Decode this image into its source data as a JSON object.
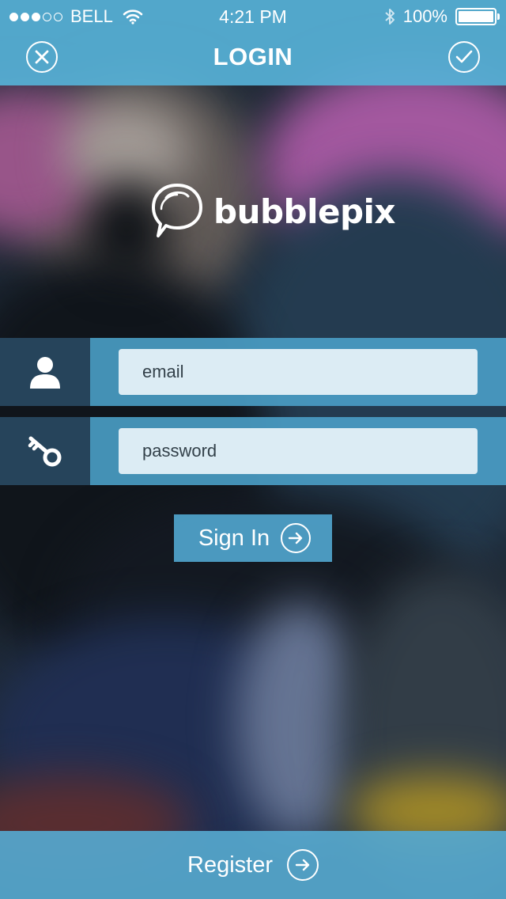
{
  "status_bar": {
    "carrier": "BELL",
    "time": "4:21 PM",
    "battery_text": "100%",
    "signal_dots_filled": 3,
    "signal_dots_total": 5
  },
  "nav": {
    "title": "LOGIN",
    "close_icon": "close-circle-icon",
    "done_icon": "check-circle-icon"
  },
  "logo": {
    "text": "bubblepix",
    "icon": "speech-bubble-icon"
  },
  "form": {
    "email": {
      "icon": "user-icon",
      "placeholder": "email",
      "value": ""
    },
    "password": {
      "icon": "key-icon",
      "placeholder": "password",
      "value": ""
    }
  },
  "signin": {
    "label": "Sign In",
    "icon": "arrow-right-circle-icon"
  },
  "register": {
    "label": "Register",
    "icon": "arrow-right-circle-icon"
  },
  "colors": {
    "header": "#56b0d6",
    "icon_cell": "#284860",
    "field_cell": "#4a9ec6",
    "input_bg": "#dcecf4"
  }
}
